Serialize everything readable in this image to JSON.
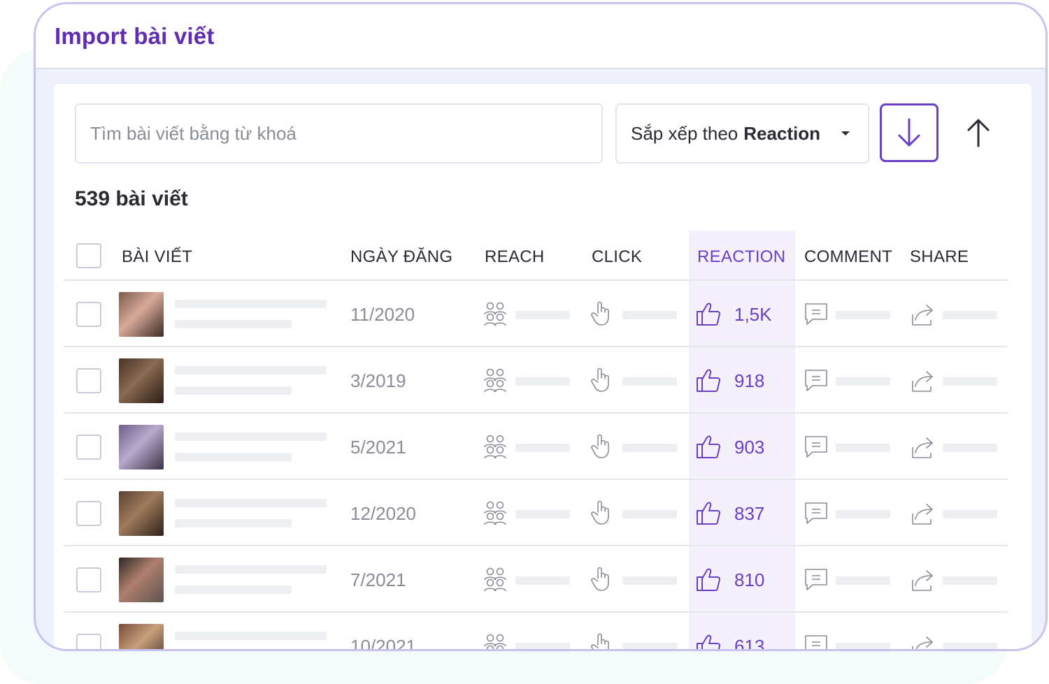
{
  "window": {
    "title": "Import bài viết"
  },
  "toolbar": {
    "search_placeholder": "Tìm bài viết bằng từ khoá",
    "sort_prefix": "Sắp xếp theo",
    "sort_value": "Reaction"
  },
  "summary": {
    "count_label": "539 bài viết"
  },
  "table": {
    "headers": {
      "post": "BÀI VIẾT",
      "date": "NGÀY ĐĂNG",
      "reach": "REACH",
      "click": "CLICK",
      "reaction": "REACTION",
      "comment": "COMMENT",
      "share": "SHARE"
    },
    "rows": [
      {
        "date": "11/2020",
        "reaction": "1,5K"
      },
      {
        "date": "3/2019",
        "reaction": "918"
      },
      {
        "date": "5/2021",
        "reaction": "903"
      },
      {
        "date": "12/2020",
        "reaction": "837"
      },
      {
        "date": "7/2021",
        "reaction": "810"
      },
      {
        "date": "10/2021",
        "reaction": "613"
      }
    ]
  },
  "colors": {
    "accent": "#6a3fc8",
    "title": "#5f2db4",
    "highlight_column": "#f5f1fc"
  }
}
